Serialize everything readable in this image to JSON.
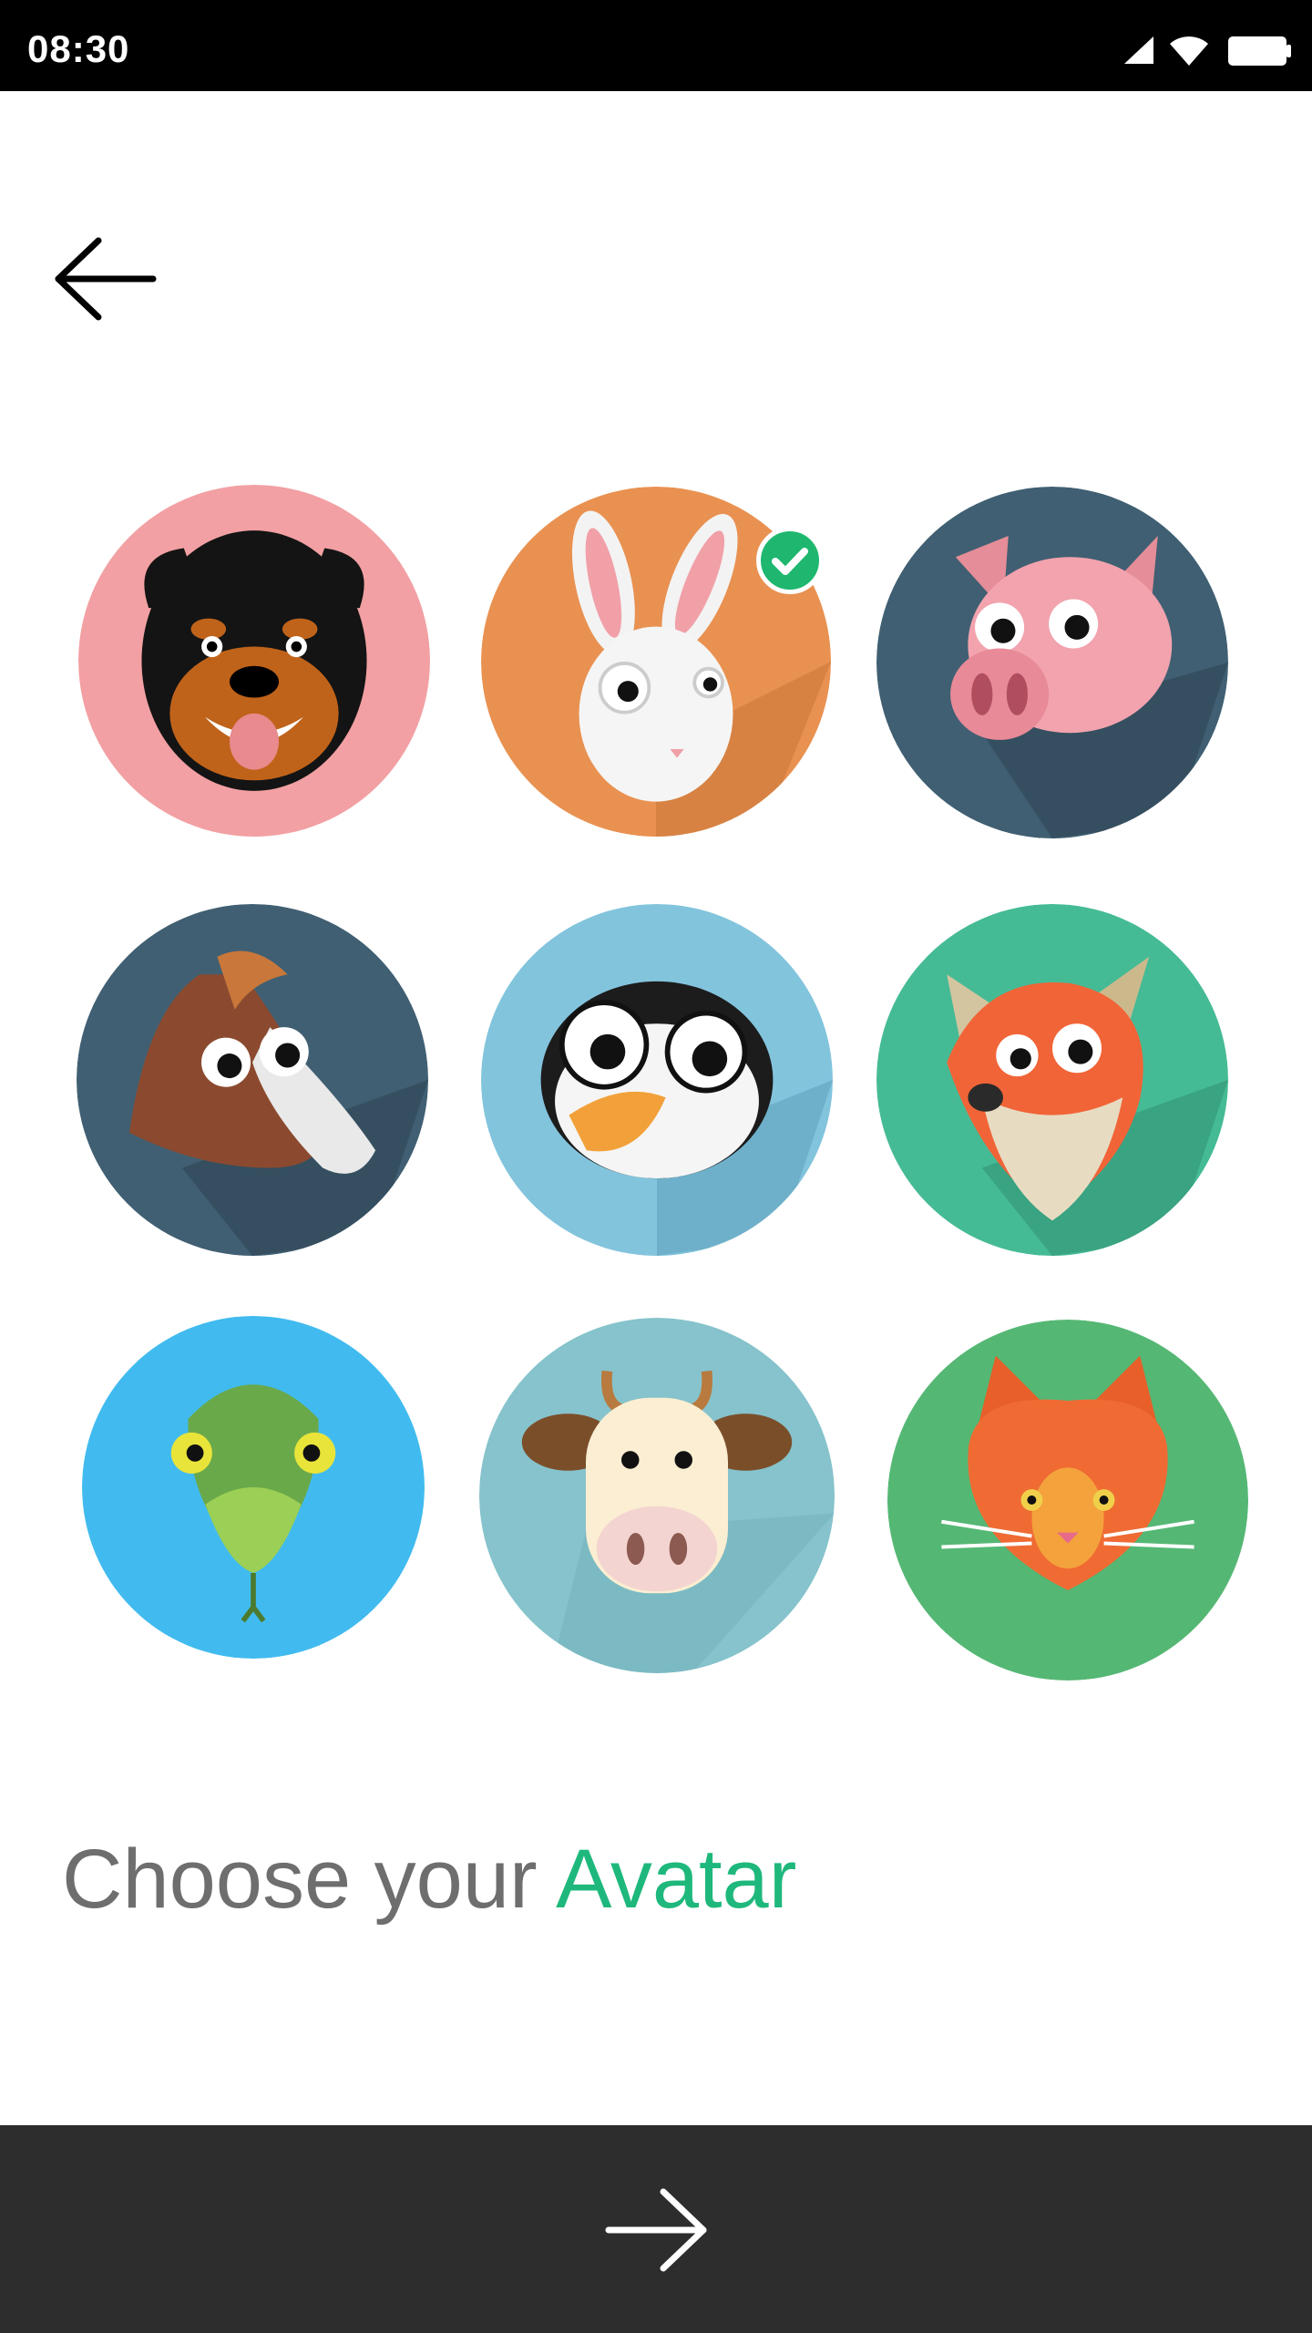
{
  "status_bar": {
    "time": "08:30",
    "icons": [
      "signal-icon",
      "wifi-icon",
      "battery-icon"
    ]
  },
  "header": {
    "back_icon": "arrow-left-icon"
  },
  "avatars": [
    {
      "animal": "dog",
      "bg_color": "#f2a0a3",
      "selected": false
    },
    {
      "animal": "rabbit",
      "bg_color": "#e99151",
      "selected": true
    },
    {
      "animal": "pig",
      "bg_color": "#405f72",
      "selected": false
    },
    {
      "animal": "horse",
      "bg_color": "#405f72",
      "selected": false
    },
    {
      "animal": "penguin",
      "bg_color": "#83c4dd",
      "selected": false
    },
    {
      "animal": "fox",
      "bg_color": "#45bb95",
      "selected": false
    },
    {
      "animal": "snake",
      "bg_color": "#41bbef",
      "selected": false
    },
    {
      "animal": "cow",
      "bg_color": "#86c3cc",
      "selected": false
    },
    {
      "animal": "cat",
      "bg_color": "#55b774",
      "selected": false
    }
  ],
  "title": {
    "prefix": "Choose your ",
    "highlight": "Avatar"
  },
  "footer": {
    "next_icon": "arrow-right-icon",
    "bg_color": "#2d2d2d"
  },
  "colors": {
    "accent": "#1fb87c",
    "selected_badge": "#1fb76f"
  }
}
